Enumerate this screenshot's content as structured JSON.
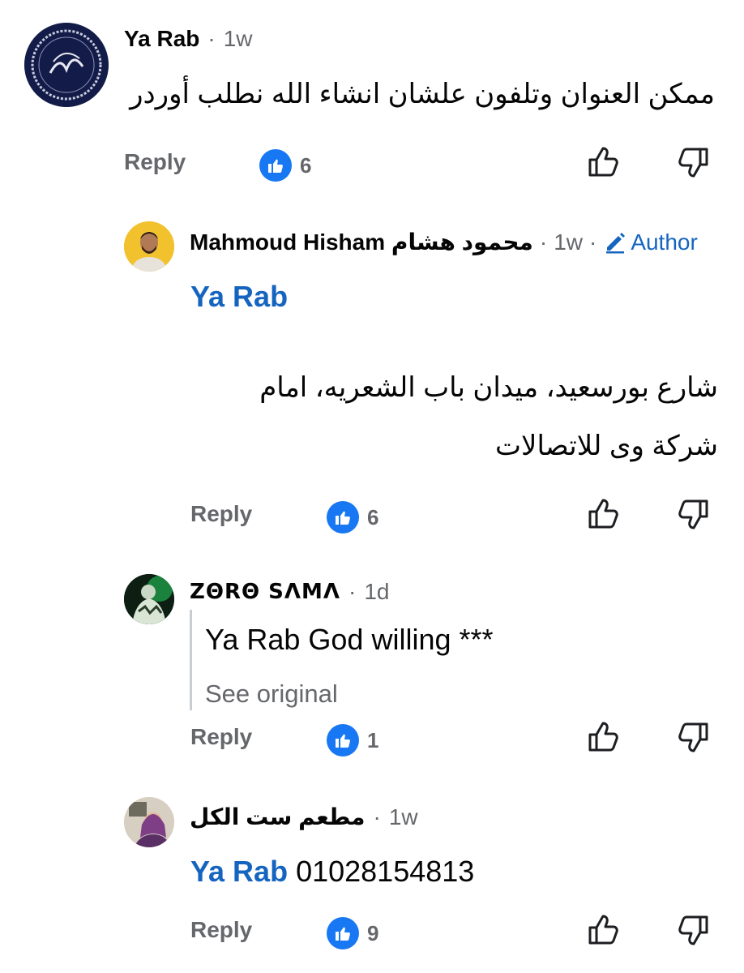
{
  "comments": [
    {
      "author": "Ya Rab",
      "time": "1w",
      "text": "ممكن العنوان وتلفون علشان  انشاء الله نطلب أوردر",
      "reply_label": "Reply",
      "likes": "6"
    },
    {
      "author": "Mahmoud Hisham محمود هشام",
      "time": "1w",
      "badge": "Author",
      "mention": "Ya Rab",
      "text_line1": "شارع بورسعيد،  ميدان باب الشعريه،  امام",
      "text_line2": "شركة وى للاتصالات",
      "reply_label": "Reply",
      "likes": "6"
    },
    {
      "author": "ZΘRΘ SΛMΛ",
      "time": "1d",
      "text": "Ya Rab God willing ***",
      "see_original": "See original",
      "reply_label": "Reply",
      "likes": "1"
    },
    {
      "author": "مطعم ست الكل",
      "time": "1w",
      "mention": "Ya Rab",
      "text": "01028154813",
      "reply_label": "Reply",
      "likes": "9"
    }
  ],
  "icons": {
    "like_badge": "thumbs-up-icon",
    "upvote": "upvote-icon",
    "downvote": "downvote-icon",
    "edit": "pencil-icon"
  },
  "colors": {
    "link_blue": "#1565c0",
    "like_blue": "#1877f2",
    "secondary_text": "#65676b"
  }
}
